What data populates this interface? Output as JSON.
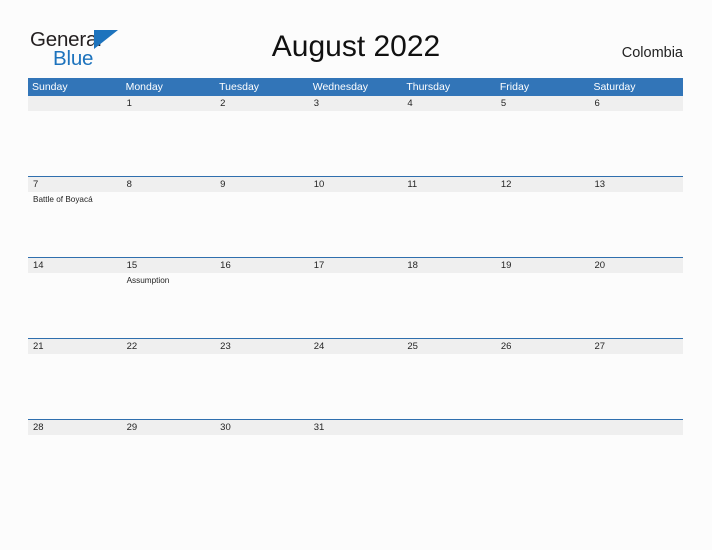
{
  "brand": {
    "name_part1": "General",
    "name_part2": "Blue",
    "color_dark": "#231f20",
    "color_blue": "#1d73bd",
    "flag_icon": "triangle-flag-icon"
  },
  "header": {
    "title": "August 2022",
    "country": "Colombia"
  },
  "theme": {
    "header_blue": "#3275b8",
    "rule_blue": "#2f6fae",
    "date_band_gray": "#efefef",
    "page_background": "#fcfcfc",
    "text": "#242424"
  },
  "calendar": {
    "weekdays": [
      "Sunday",
      "Monday",
      "Tuesday",
      "Wednesday",
      "Thursday",
      "Friday",
      "Saturday"
    ],
    "weeks": [
      {
        "days": [
          {
            "number": "",
            "events": []
          },
          {
            "number": "1",
            "events": []
          },
          {
            "number": "2",
            "events": []
          },
          {
            "number": "3",
            "events": []
          },
          {
            "number": "4",
            "events": []
          },
          {
            "number": "5",
            "events": []
          },
          {
            "number": "6",
            "events": []
          }
        ]
      },
      {
        "days": [
          {
            "number": "7",
            "events": [
              "Battle of Boyacá"
            ]
          },
          {
            "number": "8",
            "events": []
          },
          {
            "number": "9",
            "events": []
          },
          {
            "number": "10",
            "events": []
          },
          {
            "number": "11",
            "events": []
          },
          {
            "number": "12",
            "events": []
          },
          {
            "number": "13",
            "events": []
          }
        ]
      },
      {
        "days": [
          {
            "number": "14",
            "events": []
          },
          {
            "number": "15",
            "events": [
              "Assumption"
            ]
          },
          {
            "number": "16",
            "events": []
          },
          {
            "number": "17",
            "events": []
          },
          {
            "number": "18",
            "events": []
          },
          {
            "number": "19",
            "events": []
          },
          {
            "number": "20",
            "events": []
          }
        ]
      },
      {
        "days": [
          {
            "number": "21",
            "events": []
          },
          {
            "number": "22",
            "events": []
          },
          {
            "number": "23",
            "events": []
          },
          {
            "number": "24",
            "events": []
          },
          {
            "number": "25",
            "events": []
          },
          {
            "number": "26",
            "events": []
          },
          {
            "number": "27",
            "events": []
          }
        ]
      },
      {
        "days": [
          {
            "number": "28",
            "events": []
          },
          {
            "number": "29",
            "events": []
          },
          {
            "number": "30",
            "events": []
          },
          {
            "number": "31",
            "events": []
          },
          {
            "number": "",
            "events": []
          },
          {
            "number": "",
            "events": []
          },
          {
            "number": "",
            "events": []
          }
        ]
      }
    ]
  }
}
